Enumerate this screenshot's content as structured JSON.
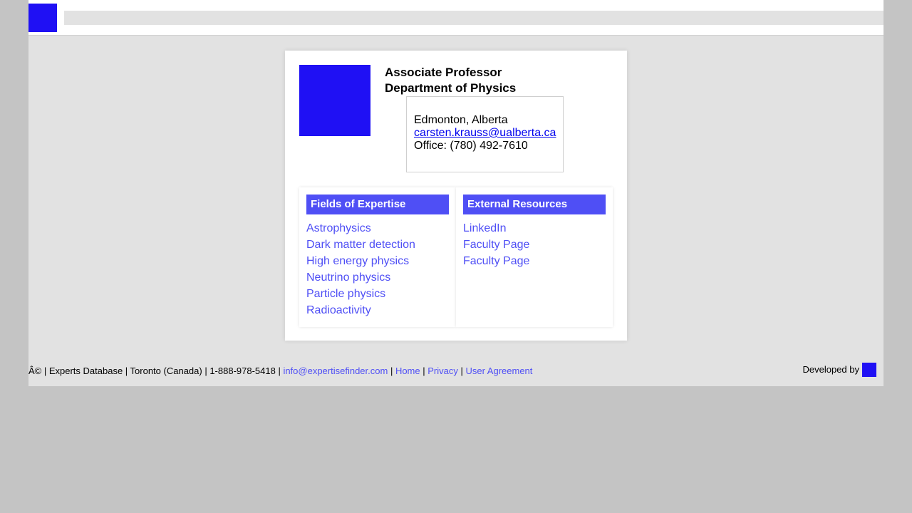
{
  "header": {
    "search_placeholder": ""
  },
  "profile": {
    "title_line1": "Associate Professor",
    "title_line2": "Department of Physics",
    "location": "Edmonton, Alberta",
    "email": "carsten.krauss@ualberta.ca",
    "office": "Office: (780) 492-7610"
  },
  "expertise": {
    "heading": "Fields of Expertise",
    "items": [
      "Astrophysics",
      "Dark matter detection",
      "High energy physics",
      "Neutrino physics",
      "Particle physics",
      "Radioactivity"
    ]
  },
  "resources": {
    "heading": "External Resources",
    "items": [
      "LinkedIn",
      "Faculty Page",
      "Faculty Page"
    ]
  },
  "footer": {
    "prefix": "Â© | Experts Database | Toronto (Canada) | 1-888-978-5418 | ",
    "email": "info@expertisefinder.com",
    "sep1": " | ",
    "home": "Home",
    "sep2": " | ",
    "privacy": "Privacy",
    "sep3": " | ",
    "agreement": "User Agreement",
    "developed_by": "Developed by"
  },
  "colors": {
    "brand_blue": "#1f10f4",
    "accent": "#4f4ff5"
  }
}
